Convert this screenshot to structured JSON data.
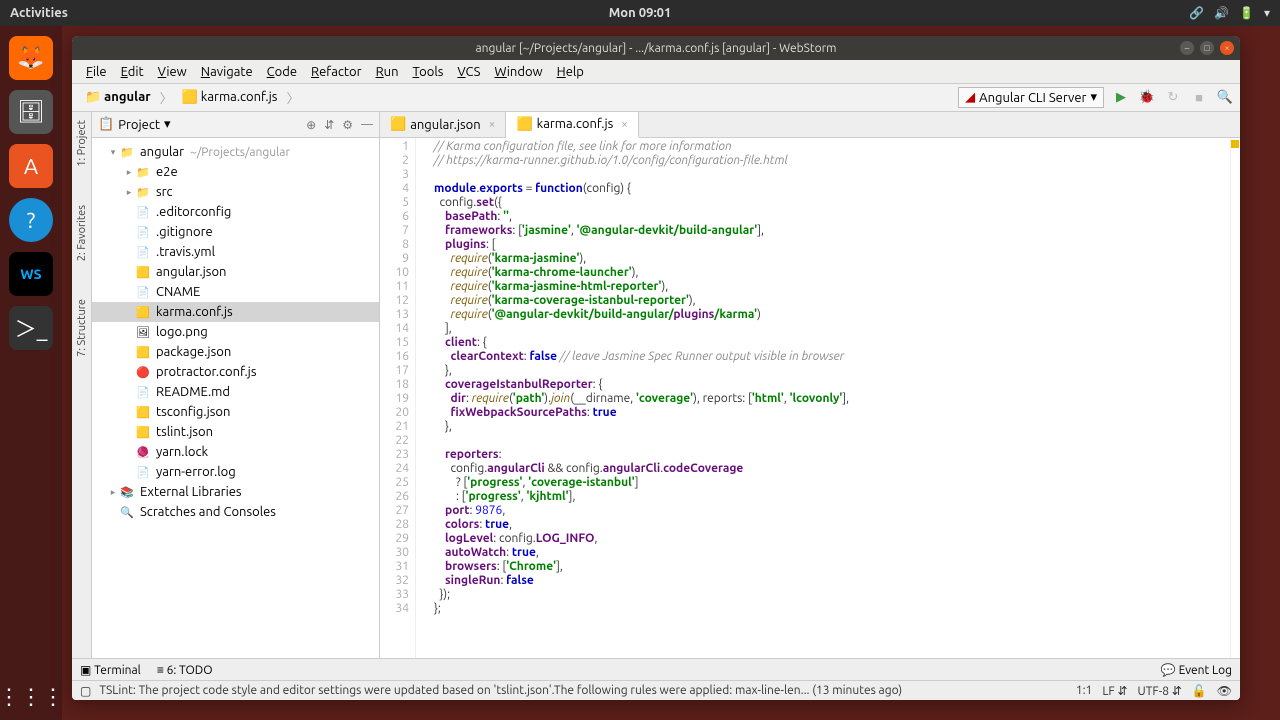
{
  "ubuntu": {
    "activities": "Activities",
    "clock": "Mon 09:01",
    "tray": [
      "🔗",
      "🔊",
      "🔋",
      "▾"
    ]
  },
  "window": {
    "title": "angular [~/Projects/angular] - .../karma.conf.js [angular] - WebStorm"
  },
  "menus": [
    "File",
    "Edit",
    "View",
    "Navigate",
    "Code",
    "Refactor",
    "Run",
    "Tools",
    "VCS",
    "Window",
    "Help"
  ],
  "breadcrumbs": [
    {
      "label": "angular",
      "icon": "📁"
    },
    {
      "label": "karma.conf.js",
      "icon": "🟨"
    }
  ],
  "run_config": {
    "label": "Angular CLI Server"
  },
  "left_tabs": [
    "1: Project",
    "2: Favorites",
    "7: Structure"
  ],
  "project_panel": {
    "title": "Project",
    "tree": [
      {
        "depth": 0,
        "arrow": "▾",
        "icon": "📁",
        "label": "angular",
        "path": "~/Projects/angular"
      },
      {
        "depth": 1,
        "arrow": "▸",
        "icon": "📁",
        "label": "e2e"
      },
      {
        "depth": 1,
        "arrow": "▸",
        "icon": "📁",
        "label": "src"
      },
      {
        "depth": 1,
        "arrow": "",
        "icon": "📄",
        "label": ".editorconfig"
      },
      {
        "depth": 1,
        "arrow": "",
        "icon": "📄",
        "label": ".gitignore"
      },
      {
        "depth": 1,
        "arrow": "",
        "icon": "📄",
        "label": ".travis.yml"
      },
      {
        "depth": 1,
        "arrow": "",
        "icon": "🟨",
        "label": "angular.json"
      },
      {
        "depth": 1,
        "arrow": "",
        "icon": "📄",
        "label": "CNAME"
      },
      {
        "depth": 1,
        "arrow": "",
        "icon": "🟨",
        "label": "karma.conf.js",
        "selected": true
      },
      {
        "depth": 1,
        "arrow": "",
        "icon": "🖼",
        "label": "logo.png"
      },
      {
        "depth": 1,
        "arrow": "",
        "icon": "🟨",
        "label": "package.json"
      },
      {
        "depth": 1,
        "arrow": "",
        "icon": "🔴",
        "label": "protractor.conf.js"
      },
      {
        "depth": 1,
        "arrow": "",
        "icon": "📄",
        "label": "README.md"
      },
      {
        "depth": 1,
        "arrow": "",
        "icon": "🟨",
        "label": "tsconfig.json"
      },
      {
        "depth": 1,
        "arrow": "",
        "icon": "🟨",
        "label": "tslint.json"
      },
      {
        "depth": 1,
        "arrow": "",
        "icon": "🧶",
        "label": "yarn.lock"
      },
      {
        "depth": 1,
        "arrow": "",
        "icon": "📄",
        "label": "yarn-error.log"
      },
      {
        "depth": 0,
        "arrow": "▸",
        "icon": "📚",
        "label": "External Libraries"
      },
      {
        "depth": 0,
        "arrow": "",
        "icon": "🔍",
        "label": "Scratches and Consoles"
      }
    ]
  },
  "tabs": [
    {
      "label": "angular.json",
      "icon": "🟨",
      "active": false
    },
    {
      "label": "karma.conf.js",
      "icon": "🟨",
      "active": true
    }
  ],
  "code_lines": [
    "// Karma configuration file, see link for more information",
    "// https://karma-runner.github.io/1.0/config/configuration-file.html",
    "",
    "module.exports = function(config) {",
    "  config.set({",
    "    basePath: '',",
    "    frameworks: ['jasmine', '@angular-devkit/build-angular'],",
    "    plugins: [",
    "      require('karma-jasmine'),",
    "      require('karma-chrome-launcher'),",
    "      require('karma-jasmine-html-reporter'),",
    "      require('karma-coverage-istanbul-reporter'),",
    "      require('@angular-devkit/build-angular/plugins/karma')",
    "    ],",
    "    client: {",
    "      clearContext: false // leave Jasmine Spec Runner output visible in browser",
    "    },",
    "    coverageIstanbulReporter: {",
    "      dir: require('path').join(__dirname, 'coverage'), reports: ['html', 'lcovonly'],",
    "      fixWebpackSourcePaths: true",
    "    },",
    "",
    "    reporters:",
    "      config.angularCli && config.angularCli.codeCoverage",
    "        ? ['progress', 'coverage-istanbul']",
    "        : ['progress', 'kjhtml'],",
    "    port: 9876,",
    "    colors: true,",
    "    logLevel: config.LOG_INFO,",
    "    autoWatch: true,",
    "    browsers: ['Chrome'],",
    "    singleRun: false",
    "  });",
    "};"
  ],
  "bottom_tools": {
    "terminal": "Terminal",
    "todo": "6: TODO",
    "event_log": "Event Log"
  },
  "status": {
    "msg": "TSLint: The project code style and editor settings were updated based on 'tslint.json'.The following rules were applied: max-line-len... (13 minutes ago)",
    "pos": "1:1",
    "le": "LF",
    "enc": "UTF-8"
  }
}
